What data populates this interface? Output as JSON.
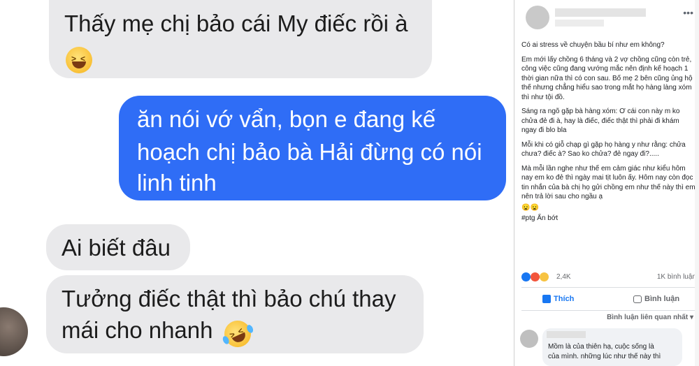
{
  "chat": {
    "messages": [
      {
        "side": "in",
        "text": "Thấy mẹ chị bảo cái My điếc rồi à",
        "emoji": "grinning-squinting-face"
      },
      {
        "side": "out",
        "lines": [
          "ăn nói vớ vẩn, bọn e đang kế",
          "hoạch chị bảo bà Hải đừng có nói",
          "linh tinh"
        ]
      },
      {
        "side": "in",
        "text": "Ai biết đâu"
      },
      {
        "side": "in",
        "lines": [
          "Tưởng điếc thật thì bảo chú thay",
          "mái cho nhanh"
        ],
        "emoji": "rolling-on-floor-laughing-face"
      }
    ]
  },
  "post": {
    "intro": "Có ai stress về chuyện bầu bí như em không?",
    "para1": "Em mới lấy chồng 6 tháng và 2 vợ chồng cũng còn trẻ, công việc cũng đang vướng mắc nên định kế hoạch 1 thời gian nữa thì có con sau. Bố mẹ 2 bên cũng ủng hộ thế nhưng chẳng hiểu sao trong mắt họ hàng làng xóm thì như tội đồ.",
    "para2": "Sáng ra ngõ gặp bà hàng xóm: Ơ cái con này m ko chửa đẻ đi à, hay là điếc, điếc thật thì phải đi khám ngay đi blo bla",
    "para3": "Mỗi khi có giỗ chạp gì gặp họ hàng y như rằng: chửa chưa? điếc à? Sao ko chửa? đẻ ngay đi?.....",
    "para4": "Mà mỗi lần nghe như thế em cảm giác như kiểu hôm nay em ko đẻ thì ngày mai tịt luôn ấy. Hôm nay còn đọc tin nhắn của bà chị họ gửi chồng em như thế này thì em nên trả lời sau cho ngầu ạ",
    "hashtag": "#ptg Ẩn bớt",
    "reaction_count": "2,4K",
    "comment_count": "1K bình luận",
    "like_label": "Thích",
    "comment_label": "Bình luận",
    "sort_label": "Bình luận liên quan nhất",
    "comment_line1": "Mồm là của thiên hạ, cuộc sống là",
    "comment_line2": "của mình. những lúc như thế này thì"
  }
}
